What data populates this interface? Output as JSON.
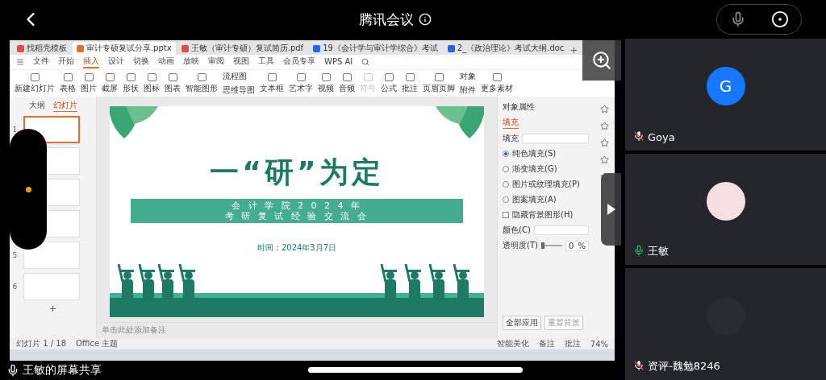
{
  "meeting": {
    "title": "腾讯会议"
  },
  "shared_screen": {
    "app_tabs": [
      {
        "label": "找稻壳模板",
        "selected": false
      },
      {
        "label": "审计专硕复试分享.pptx",
        "selected": true
      },
      {
        "label": "王敏（审计专硕）复试简历.pdf",
        "selected": false
      },
      {
        "label": "19《会计学与审计学综合》考试",
        "selected": false
      },
      {
        "label": "2_《政治理论》考试大纲.doc",
        "selected": false
      }
    ],
    "menu_tabs": [
      {
        "label": "文件",
        "selected": false
      },
      {
        "label": "开始",
        "selected": false
      },
      {
        "label": "插入",
        "selected": true
      },
      {
        "label": "设计",
        "selected": false
      },
      {
        "label": "切换",
        "selected": false
      },
      {
        "label": "动画",
        "selected": false
      },
      {
        "label": "放映",
        "selected": false
      },
      {
        "label": "审阅",
        "selected": false
      },
      {
        "label": "视图",
        "selected": false
      },
      {
        "label": "工具",
        "selected": false
      },
      {
        "label": "会员专享",
        "selected": false
      },
      {
        "label": "WPS AI",
        "selected": false
      }
    ],
    "ribbon": [
      {
        "kind": "single",
        "label": "新建幻灯片",
        "disabled": false
      },
      {
        "kind": "single",
        "label": "表格",
        "disabled": false
      },
      {
        "kind": "single",
        "label": "图片",
        "disabled": false
      },
      {
        "kind": "single",
        "label": "截屏",
        "disabled": false
      },
      {
        "kind": "single",
        "label": "形状",
        "disabled": false
      },
      {
        "kind": "single",
        "label": "图标",
        "disabled": false
      },
      {
        "kind": "single",
        "label": "图表",
        "disabled": false
      },
      {
        "kind": "single",
        "label": "智能图形",
        "disabled": false
      },
      {
        "kind": "pair",
        "labels": [
          "流程图",
          "思维导图"
        ],
        "disabled": false
      },
      {
        "kind": "single",
        "label": "文本框",
        "disabled": false
      },
      {
        "kind": "single",
        "label": "艺术字",
        "disabled": false
      },
      {
        "kind": "single",
        "label": "视频",
        "disabled": false
      },
      {
        "kind": "single",
        "label": "音频",
        "disabled": false
      },
      {
        "kind": "single",
        "label": "符号",
        "disabled": true
      },
      {
        "kind": "single",
        "label": "公式",
        "disabled": false
      },
      {
        "kind": "single",
        "label": "批注",
        "disabled": false
      },
      {
        "kind": "single",
        "label": "页眉页脚",
        "disabled": false
      },
      {
        "kind": "pair",
        "labels": [
          "对象",
          "附件"
        ],
        "disabled": false
      },
      {
        "kind": "single",
        "label": "更多素材",
        "disabled": false
      }
    ],
    "slide_pane": {
      "tabs": [
        {
          "label": "大纲",
          "selected": false
        },
        {
          "label": "幻灯片",
          "selected": true
        }
      ],
      "thumbnails": [
        {
          "number": "1",
          "selected": true
        },
        {
          "selected": false
        },
        {
          "selected": false
        },
        {
          "selected": false
        },
        {
          "number": "5",
          "selected": false
        },
        {
          "number": "6",
          "selected": false
        }
      ]
    },
    "slide": {
      "title": "一“研”为定",
      "band_lines": [
        "会 计 学 院 2 0 2 4 年",
        "考 研 复 试 经 验 交 流 会"
      ],
      "date": "时间：2024年3月7日"
    },
    "notes_placeholder": "单击此处添加备注",
    "properties": {
      "title": "对象属性",
      "tab": "填充",
      "section": "填充",
      "options": [
        {
          "kind": "radio",
          "label": "纯色填充(S)",
          "selected": true
        },
        {
          "kind": "radio",
          "label": "渐变填充(G)",
          "selected": false
        },
        {
          "kind": "radio",
          "label": "图片或纹理填充(P)",
          "selected": false
        },
        {
          "kind": "radio",
          "label": "图案填充(A)",
          "selected": false
        },
        {
          "kind": "checkbox",
          "label": "隐藏背景图形(H)",
          "checked": false
        }
      ],
      "color_label": "颜色(C)",
      "opacity_label": "透明度(T)",
      "opacity": {
        "level": 0,
        "value": "0",
        "unit": "%"
      },
      "buttons": [
        "全部应用",
        "重置背景"
      ]
    },
    "status_bar": {
      "slide_count": "幻灯片 1 / 18",
      "theme": "Office 主题",
      "items": [
        "智能美化",
        "备注",
        "批注"
      ],
      "zoom": "74%"
    }
  },
  "share_banner": "王敏的屏幕共享",
  "participants": [
    {
      "name": "Goya",
      "mic_on": false,
      "avatar": {
        "kind": "letter",
        "text": "G",
        "color": "#1677ff"
      }
    },
    {
      "name": "王敏",
      "mic_on": true,
      "avatar": {
        "kind": "image",
        "color": "#f6dfe2"
      }
    },
    {
      "name": "资评-魏勉8246",
      "mic_on": false,
      "avatar": {
        "kind": "image",
        "color": "#2a2c33"
      }
    }
  ]
}
